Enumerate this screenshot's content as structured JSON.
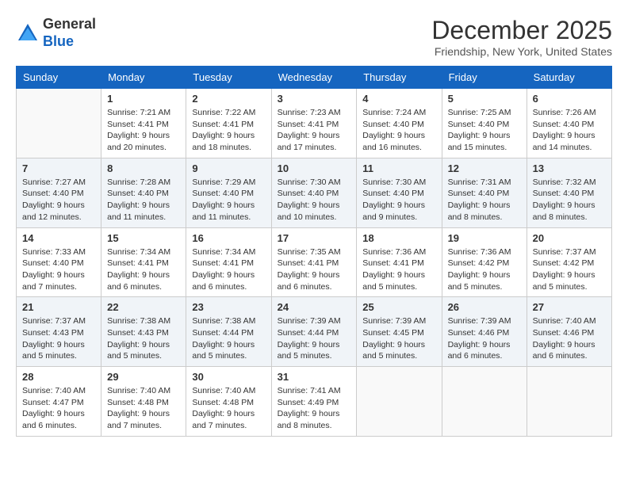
{
  "header": {
    "logo_line1": "General",
    "logo_line2": "Blue",
    "month": "December 2025",
    "location": "Friendship, New York, United States"
  },
  "columns": [
    "Sunday",
    "Monday",
    "Tuesday",
    "Wednesday",
    "Thursday",
    "Friday",
    "Saturday"
  ],
  "weeks": [
    [
      {
        "day": "",
        "info": ""
      },
      {
        "day": "1",
        "info": "Sunrise: 7:21 AM\nSunset: 4:41 PM\nDaylight: 9 hours\nand 20 minutes."
      },
      {
        "day": "2",
        "info": "Sunrise: 7:22 AM\nSunset: 4:41 PM\nDaylight: 9 hours\nand 18 minutes."
      },
      {
        "day": "3",
        "info": "Sunrise: 7:23 AM\nSunset: 4:41 PM\nDaylight: 9 hours\nand 17 minutes."
      },
      {
        "day": "4",
        "info": "Sunrise: 7:24 AM\nSunset: 4:40 PM\nDaylight: 9 hours\nand 16 minutes."
      },
      {
        "day": "5",
        "info": "Sunrise: 7:25 AM\nSunset: 4:40 PM\nDaylight: 9 hours\nand 15 minutes."
      },
      {
        "day": "6",
        "info": "Sunrise: 7:26 AM\nSunset: 4:40 PM\nDaylight: 9 hours\nand 14 minutes."
      }
    ],
    [
      {
        "day": "7",
        "info": "Sunrise: 7:27 AM\nSunset: 4:40 PM\nDaylight: 9 hours\nand 12 minutes."
      },
      {
        "day": "8",
        "info": "Sunrise: 7:28 AM\nSunset: 4:40 PM\nDaylight: 9 hours\nand 11 minutes."
      },
      {
        "day": "9",
        "info": "Sunrise: 7:29 AM\nSunset: 4:40 PM\nDaylight: 9 hours\nand 11 minutes."
      },
      {
        "day": "10",
        "info": "Sunrise: 7:30 AM\nSunset: 4:40 PM\nDaylight: 9 hours\nand 10 minutes."
      },
      {
        "day": "11",
        "info": "Sunrise: 7:30 AM\nSunset: 4:40 PM\nDaylight: 9 hours\nand 9 minutes."
      },
      {
        "day": "12",
        "info": "Sunrise: 7:31 AM\nSunset: 4:40 PM\nDaylight: 9 hours\nand 8 minutes."
      },
      {
        "day": "13",
        "info": "Sunrise: 7:32 AM\nSunset: 4:40 PM\nDaylight: 9 hours\nand 8 minutes."
      }
    ],
    [
      {
        "day": "14",
        "info": "Sunrise: 7:33 AM\nSunset: 4:40 PM\nDaylight: 9 hours\nand 7 minutes."
      },
      {
        "day": "15",
        "info": "Sunrise: 7:34 AM\nSunset: 4:41 PM\nDaylight: 9 hours\nand 6 minutes."
      },
      {
        "day": "16",
        "info": "Sunrise: 7:34 AM\nSunset: 4:41 PM\nDaylight: 9 hours\nand 6 minutes."
      },
      {
        "day": "17",
        "info": "Sunrise: 7:35 AM\nSunset: 4:41 PM\nDaylight: 9 hours\nand 6 minutes."
      },
      {
        "day": "18",
        "info": "Sunrise: 7:36 AM\nSunset: 4:41 PM\nDaylight: 9 hours\nand 5 minutes."
      },
      {
        "day": "19",
        "info": "Sunrise: 7:36 AM\nSunset: 4:42 PM\nDaylight: 9 hours\nand 5 minutes."
      },
      {
        "day": "20",
        "info": "Sunrise: 7:37 AM\nSunset: 4:42 PM\nDaylight: 9 hours\nand 5 minutes."
      }
    ],
    [
      {
        "day": "21",
        "info": "Sunrise: 7:37 AM\nSunset: 4:43 PM\nDaylight: 9 hours\nand 5 minutes."
      },
      {
        "day": "22",
        "info": "Sunrise: 7:38 AM\nSunset: 4:43 PM\nDaylight: 9 hours\nand 5 minutes."
      },
      {
        "day": "23",
        "info": "Sunrise: 7:38 AM\nSunset: 4:44 PM\nDaylight: 9 hours\nand 5 minutes."
      },
      {
        "day": "24",
        "info": "Sunrise: 7:39 AM\nSunset: 4:44 PM\nDaylight: 9 hours\nand 5 minutes."
      },
      {
        "day": "25",
        "info": "Sunrise: 7:39 AM\nSunset: 4:45 PM\nDaylight: 9 hours\nand 5 minutes."
      },
      {
        "day": "26",
        "info": "Sunrise: 7:39 AM\nSunset: 4:46 PM\nDaylight: 9 hours\nand 6 minutes."
      },
      {
        "day": "27",
        "info": "Sunrise: 7:40 AM\nSunset: 4:46 PM\nDaylight: 9 hours\nand 6 minutes."
      }
    ],
    [
      {
        "day": "28",
        "info": "Sunrise: 7:40 AM\nSunset: 4:47 PM\nDaylight: 9 hours\nand 6 minutes."
      },
      {
        "day": "29",
        "info": "Sunrise: 7:40 AM\nSunset: 4:48 PM\nDaylight: 9 hours\nand 7 minutes."
      },
      {
        "day": "30",
        "info": "Sunrise: 7:40 AM\nSunset: 4:48 PM\nDaylight: 9 hours\nand 7 minutes."
      },
      {
        "day": "31",
        "info": "Sunrise: 7:41 AM\nSunset: 4:49 PM\nDaylight: 9 hours\nand 8 minutes."
      },
      {
        "day": "",
        "info": ""
      },
      {
        "day": "",
        "info": ""
      },
      {
        "day": "",
        "info": ""
      }
    ]
  ]
}
